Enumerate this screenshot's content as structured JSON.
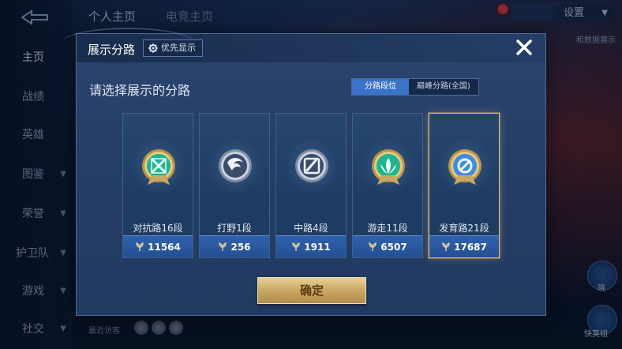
{
  "background": {
    "top_tabs": [
      "个人主页",
      "电竞主页"
    ],
    "settings_label": "设置",
    "mini_info": "",
    "right_text": "和数据展示",
    "nav_items": [
      {
        "label": "主页",
        "active": true,
        "has_chevron": false
      },
      {
        "label": "战绩",
        "active": false,
        "has_chevron": false
      },
      {
        "label": "英雄",
        "active": false,
        "has_chevron": false
      },
      {
        "label": "图鉴",
        "active": false,
        "has_chevron": true
      },
      {
        "label": "荣誉",
        "active": false,
        "has_chevron": true
      },
      {
        "label": "护卫队",
        "active": false,
        "has_chevron": true
      },
      {
        "label": "游戏",
        "active": false,
        "has_chevron": true
      },
      {
        "label": "社交",
        "active": false,
        "has_chevron": true
      }
    ],
    "recent_visitors_label": "最近访客",
    "bottom_right_labels": [
      "晓",
      "快英组"
    ]
  },
  "dialog": {
    "title": "展示分路",
    "priority_label": "优先显示",
    "subtitle": "请选择展示的分路",
    "tabs": [
      {
        "label": "分路段位",
        "active": true
      },
      {
        "label": "巅峰分路(全国)",
        "active": false
      }
    ],
    "lanes": [
      {
        "name": "对抗路16段",
        "score": "11564",
        "icon": "clash-lane-badge-icon",
        "color": "#1fb58f",
        "selected": false
      },
      {
        "name": "打野1段",
        "score": "256",
        "icon": "jungle-badge-icon",
        "color": "#8d9aae",
        "selected": false
      },
      {
        "name": "中路4段",
        "score": "1911",
        "icon": "mid-lane-badge-icon",
        "color": "#8d9aae",
        "selected": false
      },
      {
        "name": "游走11段",
        "score": "6507",
        "icon": "roam-badge-icon",
        "color": "#1fb58f",
        "selected": false
      },
      {
        "name": "发育路21段",
        "score": "17687",
        "icon": "farm-lane-badge-icon",
        "color": "#3f8de0",
        "selected": true
      }
    ],
    "confirm_label": "确定"
  },
  "colors": {
    "accent_blue": "#3a73c9",
    "gold": "#d9b873",
    "dialog_bg": "#2b456f"
  }
}
